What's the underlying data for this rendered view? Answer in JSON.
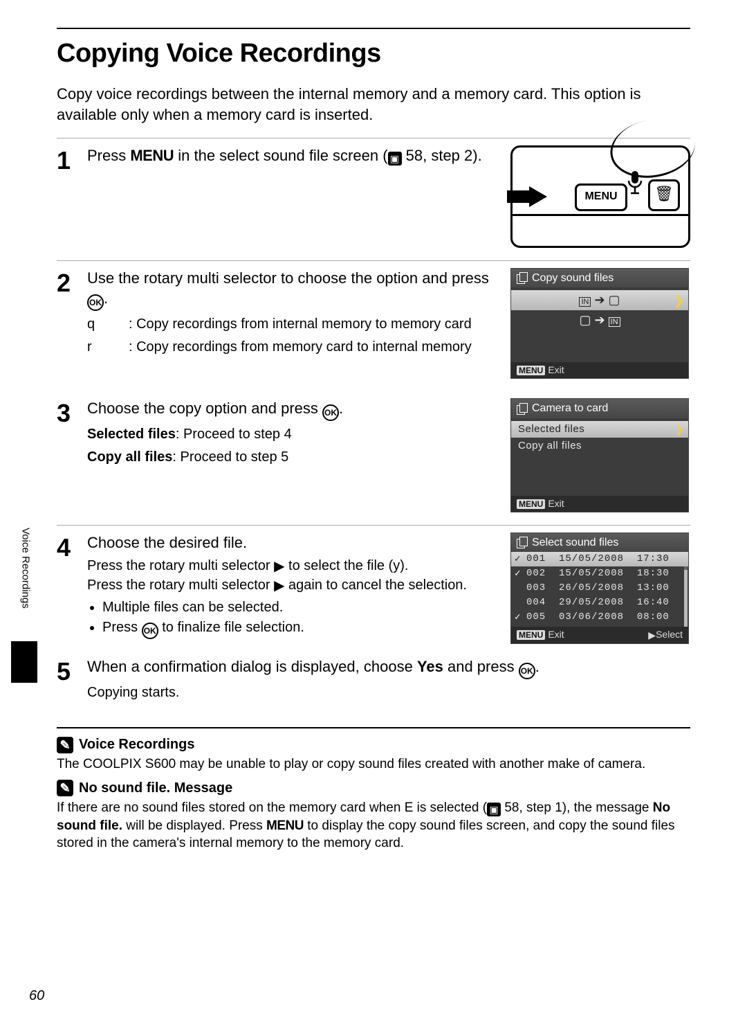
{
  "title": "Copying Voice Recordings",
  "intro": "Copy voice recordings between the internal memory and a memory card. This option is available only when a memory card is inserted.",
  "side_tab": "Voice Recordings",
  "page_number": "60",
  "steps": {
    "s1": {
      "num": "1",
      "lead_a": "Press ",
      "lead_menu": "MENU",
      "lead_b": " in the select sound file screen (",
      "lead_ref": " 58, step 2).",
      "cam_menu": "MENU"
    },
    "s2": {
      "num": "2",
      "lead_a": "Use the rotary multi selector to choose the option and press ",
      "lead_ok": "OK",
      "lead_b": ".",
      "sub1_key": "q",
      "sub1_val": ": Copy recordings from internal memory to memory card",
      "sub2_key": "r",
      "sub2_val": ": Copy recordings from memory card to internal memory",
      "lcd_title": "Copy sound files",
      "lcd_exit": "Exit"
    },
    "s3": {
      "num": "3",
      "lead_a": "Choose the copy option and press ",
      "lead_ok": "OK",
      "lead_b": ".",
      "sub1_key": "Selected files",
      "sub1_val": ": Proceed to step 4",
      "sub2_key": "Copy all files",
      "sub2_val": ": Proceed to step 5",
      "lcd_title": "Camera to card",
      "lcd_opt1": "Selected files",
      "lcd_opt2": "Copy all files",
      "lcd_exit": "Exit"
    },
    "s4": {
      "num": "4",
      "lead": "Choose the desired file.",
      "sub_a": "Press the rotary multi selector ",
      "sub_b": " to select the file (",
      "sub_c": "y",
      "sub_d": ").",
      "sub_e": "Press the rotary multi selector ",
      "sub_f": " again to cancel the selection.",
      "b1": "Multiple files can be selected.",
      "b2_a": "Press ",
      "b2_ok": "OK",
      "b2_b": " to finalize file selection.",
      "lcd_title": "Select sound files",
      "rows": [
        {
          "mark": "✓",
          "n": "001",
          "d": "15/05/2008",
          "t": "17:30",
          "sel": true
        },
        {
          "mark": "✓",
          "n": "002",
          "d": "15/05/2008",
          "t": "18:30",
          "sel": false
        },
        {
          "mark": "",
          "n": "003",
          "d": "26/05/2008",
          "t": "13:00",
          "sel": false
        },
        {
          "mark": "",
          "n": "004",
          "d": "29/05/2008",
          "t": "16:40",
          "sel": false
        },
        {
          "mark": "✓",
          "n": "005",
          "d": "03/06/2008",
          "t": "08:00",
          "sel": false
        }
      ],
      "lcd_exit": "Exit",
      "lcd_select": "Select"
    },
    "s5": {
      "num": "5",
      "lead_a": "When a confirmation dialog is displayed, choose ",
      "lead_yes": "Yes",
      "lead_b": " and press ",
      "lead_ok": "OK",
      "lead_c": ".",
      "sub": "Copying starts."
    }
  },
  "notes": {
    "n1_title": "Voice Recordings",
    "n1_body": "The COOLPIX S600 may be unable to play or copy sound files created with another make of camera.",
    "n2_title": "No sound file. Message",
    "n2_a": "If there are no sound files stored on the memory card when ",
    "n2_E": "E",
    "n2_b": " is selected (",
    "n2_ref": " 58, step 1), the message ",
    "n2_bold": "No sound file.",
    "n2_c": " will be displayed. Press ",
    "n2_menu": "MENU",
    "n2_d": " to display the copy sound files screen, and copy the sound files stored in the camera's internal memory to the memory card."
  },
  "glyphs": {
    "menu_badge": "MENU",
    "play_tri": "▶",
    "in_icon": "IN",
    "sd_icon": "⎙"
  }
}
